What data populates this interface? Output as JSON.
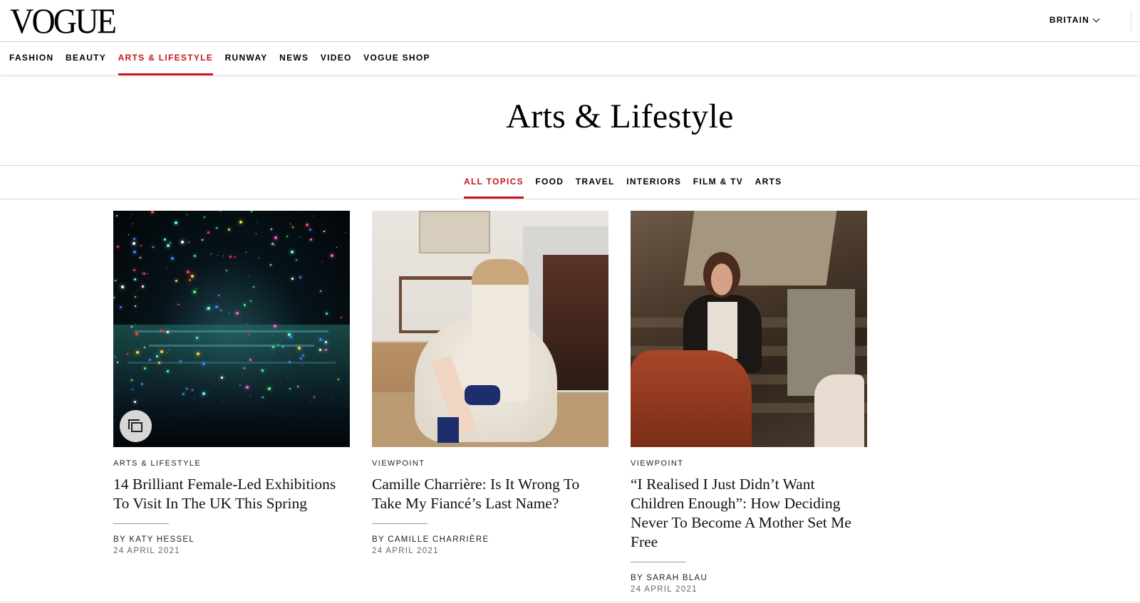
{
  "header": {
    "logo": "VOGUE",
    "edition": "BRITAIN"
  },
  "main_nav": {
    "items": [
      "FASHION",
      "BEAUTY",
      "ARTS & LIFESTYLE",
      "RUNWAY",
      "NEWS",
      "VIDEO",
      "VOGUE SHOP"
    ],
    "active": "ARTS & LIFESTYLE"
  },
  "page": {
    "title": "Arts & Lifestyle"
  },
  "sub_nav": {
    "items": [
      "ALL TOPICS",
      "FOOD",
      "TRAVEL",
      "INTERIORS",
      "FILM & TV",
      "ARTS"
    ],
    "active": "ALL TOPICS"
  },
  "articles": [
    {
      "rubric": "ARTS & LIFESTYLE",
      "headline": "14 Brilliant Female-Led Exhibitions To Visit In The UK This Spring",
      "byline": "BY KATY HESSEL",
      "date": "24 APRIL 2021",
      "gallery_icon": "gallery-icon"
    },
    {
      "rubric": "VIEWPOINT",
      "headline": "Camille Charrière: Is It Wrong To Take My Fiancé’s Last Name?",
      "byline": "BY CAMILLE CHARRIÈRE",
      "date": "24 APRIL 2021"
    },
    {
      "rubric": "VIEWPOINT",
      "headline": "“I Realised I Just Didn’t Want Children Enough”: How Deciding Never To Become A Mother Set Me Free",
      "byline": "BY SARAH BLAU",
      "date": "24 APRIL 2021"
    }
  ],
  "colors": {
    "accent": "#c4161c",
    "text": "#000000",
    "border": "#d9d9d9"
  }
}
